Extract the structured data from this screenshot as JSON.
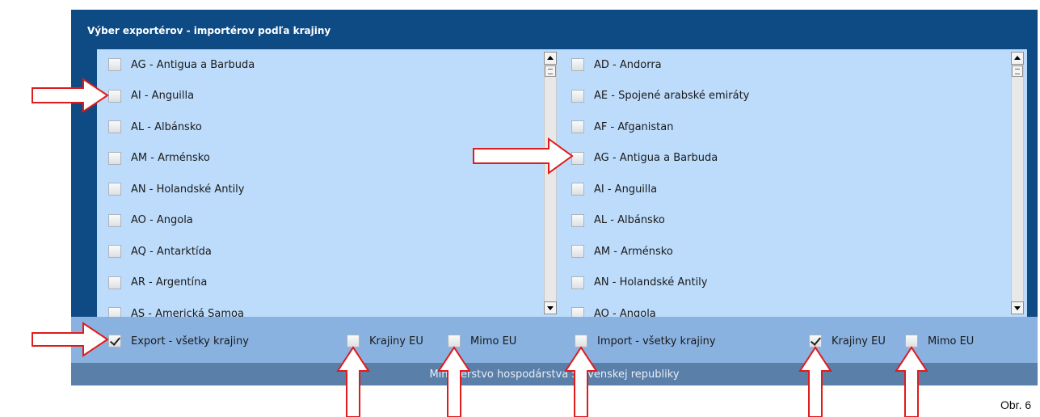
{
  "panel": {
    "title": "Výber exportérov - importérov podľa krajiny"
  },
  "export_list": {
    "items": [
      {
        "label": "AG - Antigua a Barbuda",
        "checked": false
      },
      {
        "label": "AI - Anguilla",
        "checked": false
      },
      {
        "label": "AL - Albánsko",
        "checked": false
      },
      {
        "label": "AM - Arménsko",
        "checked": false
      },
      {
        "label": "AN - Holandské Antily",
        "checked": false
      },
      {
        "label": "AO - Angola",
        "checked": false
      },
      {
        "label": "AQ - Antarktída",
        "checked": false
      },
      {
        "label": "AR - Argentína",
        "checked": false
      },
      {
        "label": "AS - Americká Samoa",
        "checked": false
      }
    ]
  },
  "import_list": {
    "items": [
      {
        "label": "AD - Andorra",
        "checked": false
      },
      {
        "label": "AE - Spojené arabské emiráty",
        "checked": false
      },
      {
        "label": "AF - Afganistan",
        "checked": false
      },
      {
        "label": "AG - Antigua a Barbuda",
        "checked": false
      },
      {
        "label": "AI - Anguilla",
        "checked": false
      },
      {
        "label": "AL - Albánsko",
        "checked": false
      },
      {
        "label": "AM - Arménsko",
        "checked": false
      },
      {
        "label": "AN - Holandské Antily",
        "checked": false
      },
      {
        "label": "AO - Angola",
        "checked": false
      }
    ]
  },
  "options": {
    "export_all": {
      "label": "Export - všetky krajiny",
      "checked": true
    },
    "export_eu": {
      "label": "Krajiny EU",
      "checked": false
    },
    "export_non_eu": {
      "label": "Mimo EU",
      "checked": false
    },
    "import_all": {
      "label": "Import - všetky krajiny",
      "checked": false
    },
    "import_eu": {
      "label": "Krajiny EU",
      "checked": true
    },
    "import_non_eu": {
      "label": "Mimo EU",
      "checked": false
    }
  },
  "footer": {
    "text": "Ministerstvo hospodárstva Slovenskej republiky"
  },
  "caption": "Obr. 6",
  "colors": {
    "panel": "#0e4a84",
    "list_bg": "#bddcfb",
    "options_bg": "#89b2e1",
    "footer_bg": "#5a7fa8",
    "annotation_arrow": "#e01b1b"
  }
}
